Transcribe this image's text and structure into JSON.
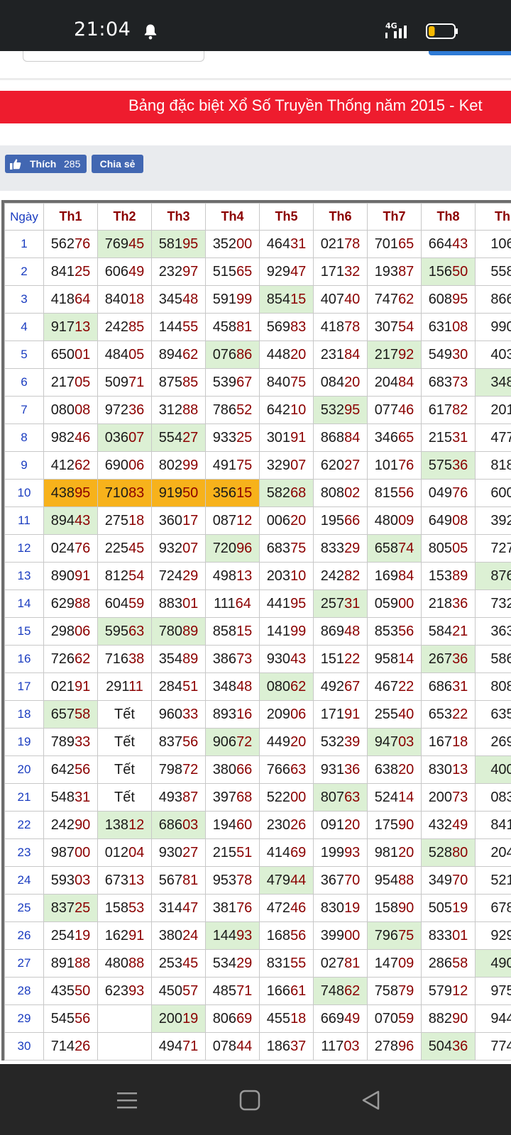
{
  "status": {
    "time": "21:04",
    "network": "4G",
    "battery_level": 0.25
  },
  "banner": {
    "text": "Bảng đặc biệt Xổ Số Truyền Thống năm 2015 - Ket"
  },
  "share": {
    "like_label": "Thích",
    "like_count": "285",
    "share_label": "Chia sẻ"
  },
  "table": {
    "columns": [
      "Ngày",
      "Th1",
      "Th2",
      "Th3",
      "Th4",
      "Th5",
      "Th6",
      "Th7",
      "Th8",
      "Th"
    ],
    "rows": [
      [
        "1",
        "56276",
        "76945",
        "58195",
        "35200",
        "46431",
        "02178",
        "70165",
        "66443",
        "106"
      ],
      [
        "2",
        "84125",
        "60649",
        "23297",
        "51565",
        "92947",
        "17132",
        "19387",
        "15650",
        "558"
      ],
      [
        "3",
        "41864",
        "84018",
        "34548",
        "59199",
        "85415",
        "40740",
        "74762",
        "60895",
        "866"
      ],
      [
        "4",
        "91713",
        "24285",
        "14455",
        "45881",
        "56983",
        "41878",
        "30754",
        "63108",
        "990"
      ],
      [
        "5",
        "65001",
        "48405",
        "89462",
        "07686",
        "44820",
        "23184",
        "21792",
        "54930",
        "403"
      ],
      [
        "6",
        "21705",
        "50971",
        "87585",
        "53967",
        "84075",
        "08420",
        "20484",
        "68373",
        "348"
      ],
      [
        "7",
        "08008",
        "97236",
        "31288",
        "78652",
        "64210",
        "53295",
        "07746",
        "61782",
        "201"
      ],
      [
        "8",
        "98246",
        "03607",
        "55427",
        "93325",
        "30191",
        "86884",
        "34665",
        "21531",
        "477"
      ],
      [
        "9",
        "41262",
        "69006",
        "80299",
        "49175",
        "32907",
        "62027",
        "10176",
        "57536",
        "818"
      ],
      [
        "10",
        "43895",
        "71083",
        "91950",
        "35615",
        "58268",
        "80802",
        "81556",
        "04976",
        "600"
      ],
      [
        "11",
        "89443",
        "27518",
        "36017",
        "08712",
        "00620",
        "19566",
        "48009",
        "64908",
        "392"
      ],
      [
        "12",
        "02476",
        "22545",
        "93207",
        "72096",
        "68375",
        "83329",
        "65874",
        "80505",
        "727"
      ],
      [
        "13",
        "89091",
        "81254",
        "72429",
        "49813",
        "20310",
        "24282",
        "16984",
        "15389",
        "876"
      ],
      [
        "14",
        "62988",
        "60459",
        "88301",
        "11164",
        "44195",
        "25731",
        "05900",
        "21836",
        "732"
      ],
      [
        "15",
        "29806",
        "59563",
        "78089",
        "85815",
        "14199",
        "86948",
        "85356",
        "58421",
        "363"
      ],
      [
        "16",
        "72662",
        "71638",
        "35489",
        "38673",
        "93043",
        "15122",
        "95814",
        "26736",
        "586"
      ],
      [
        "17",
        "02191",
        "29111",
        "28451",
        "34848",
        "08062",
        "49267",
        "46722",
        "68631",
        "808"
      ],
      [
        "18",
        "65758",
        "Tết",
        "96033",
        "89316",
        "20906",
        "17191",
        "25540",
        "65322",
        "635"
      ],
      [
        "19",
        "78933",
        "Tết",
        "83756",
        "90672",
        "44920",
        "53239",
        "94703",
        "16718",
        "269"
      ],
      [
        "20",
        "64256",
        "Tết",
        "79872",
        "38066",
        "76663",
        "93136",
        "63820",
        "83013",
        "400"
      ],
      [
        "21",
        "54831",
        "Tết",
        "49387",
        "39768",
        "52200",
        "80763",
        "52414",
        "20073",
        "083"
      ],
      [
        "22",
        "24290",
        "13812",
        "68603",
        "19460",
        "23026",
        "09120",
        "17590",
        "43249",
        "841"
      ],
      [
        "23",
        "98700",
        "01204",
        "93027",
        "21551",
        "41469",
        "19993",
        "98120",
        "52880",
        "204"
      ],
      [
        "24",
        "59303",
        "67313",
        "56781",
        "95378",
        "47944",
        "36770",
        "95488",
        "34970",
        "521"
      ],
      [
        "25",
        "83725",
        "15853",
        "31447",
        "38176",
        "47246",
        "83019",
        "15890",
        "50519",
        "678"
      ],
      [
        "26",
        "25419",
        "16291",
        "38024",
        "14493",
        "16856",
        "39900",
        "79675",
        "83301",
        "929"
      ],
      [
        "27",
        "89188",
        "48088",
        "25345",
        "53429",
        "83155",
        "02781",
        "14709",
        "28658",
        "490"
      ],
      [
        "28",
        "43550",
        "62393",
        "45057",
        "48571",
        "16661",
        "74862",
        "75879",
        "57912",
        "975"
      ],
      [
        "29",
        "54556",
        "",
        "20019",
        "80669",
        "45518",
        "66949",
        "07059",
        "88290",
        "944"
      ],
      [
        "30",
        "71426",
        "",
        "49471",
        "07844",
        "18637",
        "11703",
        "27896",
        "50436",
        "774"
      ]
    ],
    "highlights_green": [
      [
        1,
        2
      ],
      [
        1,
        3
      ],
      [
        2,
        8
      ],
      [
        3,
        5
      ],
      [
        4,
        1
      ],
      [
        5,
        4
      ],
      [
        5,
        7
      ],
      [
        6,
        9
      ],
      [
        7,
        6
      ],
      [
        8,
        2
      ],
      [
        8,
        3
      ],
      [
        9,
        8
      ],
      [
        10,
        5
      ],
      [
        11,
        1
      ],
      [
        12,
        4
      ],
      [
        12,
        7
      ],
      [
        13,
        9
      ],
      [
        14,
        6
      ],
      [
        15,
        2
      ],
      [
        15,
        3
      ],
      [
        16,
        8
      ],
      [
        17,
        5
      ],
      [
        18,
        1
      ],
      [
        19,
        4
      ],
      [
        19,
        7
      ],
      [
        20,
        9
      ],
      [
        21,
        6
      ],
      [
        22,
        2
      ],
      [
        22,
        3
      ],
      [
        23,
        8
      ],
      [
        24,
        5
      ],
      [
        25,
        1
      ],
      [
        26,
        4
      ],
      [
        26,
        7
      ],
      [
        27,
        9
      ],
      [
        28,
        6
      ],
      [
        29,
        3
      ],
      [
        30,
        8
      ]
    ],
    "highlights_orange": [
      [
        10,
        1
      ],
      [
        10,
        2
      ],
      [
        10,
        3
      ],
      [
        10,
        4
      ]
    ],
    "colors": {
      "green_bg": "#dcf0d4",
      "orange_bg": "#f7b21b",
      "day_blue": "#1a3cc0",
      "tail_red": "#8b0000"
    }
  },
  "icons": {
    "notification": "bell-icon",
    "like": "thumbs-up-icon",
    "nav_menu": "menu-icon",
    "nav_home": "home-icon",
    "nav_back": "back-icon"
  },
  "colors": {
    "banner_bg": "#ee1c2e",
    "fb_blue": "#4267b2",
    "status_bar": "#1f2224",
    "nav_bar": "#262626"
  }
}
